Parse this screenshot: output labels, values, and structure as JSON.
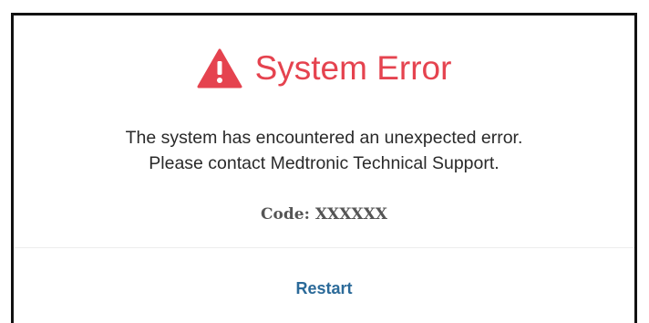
{
  "dialog": {
    "title": "System Error",
    "title_color": "#e5434f",
    "icon": "warning-triangle-icon",
    "message_lines": [
      "The system has encountered an unexpected error.",
      "Please contact Medtronic Technical Support."
    ],
    "code_label": "Code:",
    "code_value": "XXXXXX",
    "restart_label": "Restart",
    "restart_color": "#2b6a99"
  }
}
